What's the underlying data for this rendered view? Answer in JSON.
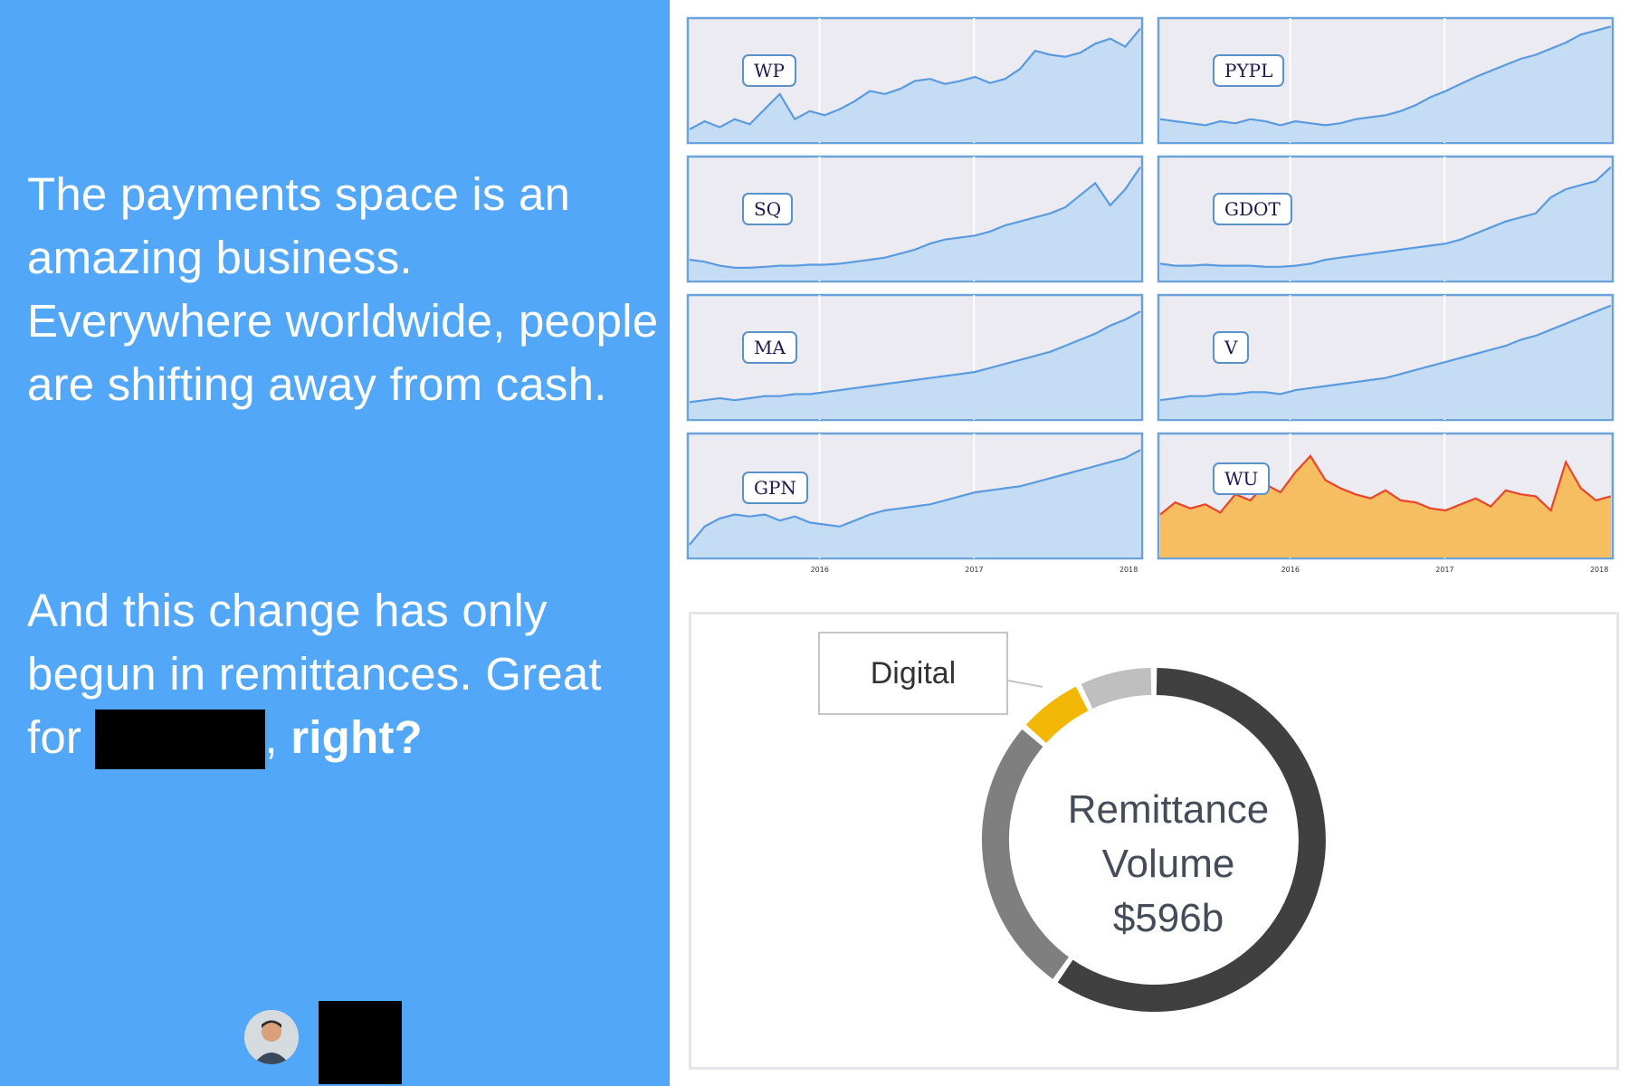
{
  "left": {
    "paragraph1": "The payments space is an amazing business. Everywhere worldwide, people are shifting away from cash.",
    "paragraph2_line1": "And this change has only begun in remittances.",
    "paragraph2_prefix": "Great for",
    "paragraph2_suffix": ",",
    "paragraph2_bold": " right?"
  },
  "charts": [
    {
      "ticker": "WP",
      "color": "blue",
      "values": [
        10,
        18,
        12,
        20,
        15,
        30,
        45,
        20,
        28,
        24,
        30,
        38,
        48,
        45,
        50,
        58,
        60,
        55,
        58,
        62,
        56,
        60,
        70,
        88,
        84,
        82,
        86,
        95,
        100,
        92,
        110
      ]
    },
    {
      "ticker": "PYPL",
      "color": "blue",
      "values": [
        20,
        18,
        16,
        14,
        18,
        16,
        20,
        18,
        14,
        18,
        16,
        14,
        16,
        20,
        22,
        24,
        28,
        34,
        42,
        48,
        55,
        62,
        68,
        74,
        80,
        84,
        90,
        96,
        104,
        108,
        112
      ]
    },
    {
      "ticker": "SQ",
      "color": "blue",
      "values": [
        18,
        16,
        12,
        10,
        10,
        11,
        12,
        12,
        13,
        13,
        14,
        16,
        18,
        20,
        24,
        28,
        34,
        38,
        40,
        42,
        46,
        52,
        56,
        60,
        64,
        70,
        82,
        94,
        72,
        88,
        110
      ]
    },
    {
      "ticker": "GDOT",
      "color": "blue",
      "values": [
        14,
        12,
        12,
        13,
        12,
        12,
        12,
        11,
        11,
        12,
        14,
        18,
        20,
        22,
        24,
        26,
        28,
        30,
        32,
        34,
        38,
        44,
        50,
        56,
        60,
        64,
        80,
        88,
        92,
        96,
        110
      ]
    },
    {
      "ticker": "MA",
      "color": "blue",
      "values": [
        14,
        16,
        18,
        16,
        18,
        20,
        20,
        22,
        22,
        24,
        26,
        28,
        30,
        32,
        34,
        36,
        38,
        40,
        42,
        44,
        48,
        52,
        56,
        60,
        64,
        70,
        76,
        82,
        90,
        96,
        104
      ]
    },
    {
      "ticker": "V",
      "color": "blue",
      "values": [
        16,
        18,
        20,
        20,
        22,
        22,
        24,
        24,
        22,
        26,
        28,
        30,
        32,
        34,
        36,
        38,
        42,
        46,
        50,
        54,
        58,
        62,
        66,
        70,
        76,
        80,
        86,
        92,
        98,
        104,
        110
      ]
    },
    {
      "ticker": "GPN",
      "color": "blue",
      "values": [
        10,
        28,
        36,
        40,
        38,
        40,
        34,
        38,
        32,
        30,
        28,
        34,
        40,
        44,
        46,
        48,
        50,
        54,
        58,
        62,
        64,
        66,
        68,
        72,
        76,
        80,
        84,
        88,
        92,
        96,
        104
      ]
    },
    {
      "ticker": "WU",
      "color": "orange",
      "values": [
        40,
        52,
        46,
        50,
        42,
        60,
        54,
        70,
        62,
        82,
        98,
        74,
        66,
        60,
        56,
        64,
        54,
        52,
        46,
        44,
        50,
        56,
        48,
        64,
        60,
        58,
        44,
        92,
        66,
        54,
        58
      ]
    }
  ],
  "axis_ticks": [
    "2016",
    "2017",
    "2018"
  ],
  "donut": {
    "center_lines": [
      "Remittance",
      "Volume",
      "$596b"
    ],
    "callout": "Digital",
    "colors": {
      "dark": "#404040",
      "mid": "#7f7f7f",
      "light": "#bfbfbf",
      "digital": "#f2b705"
    }
  }
}
